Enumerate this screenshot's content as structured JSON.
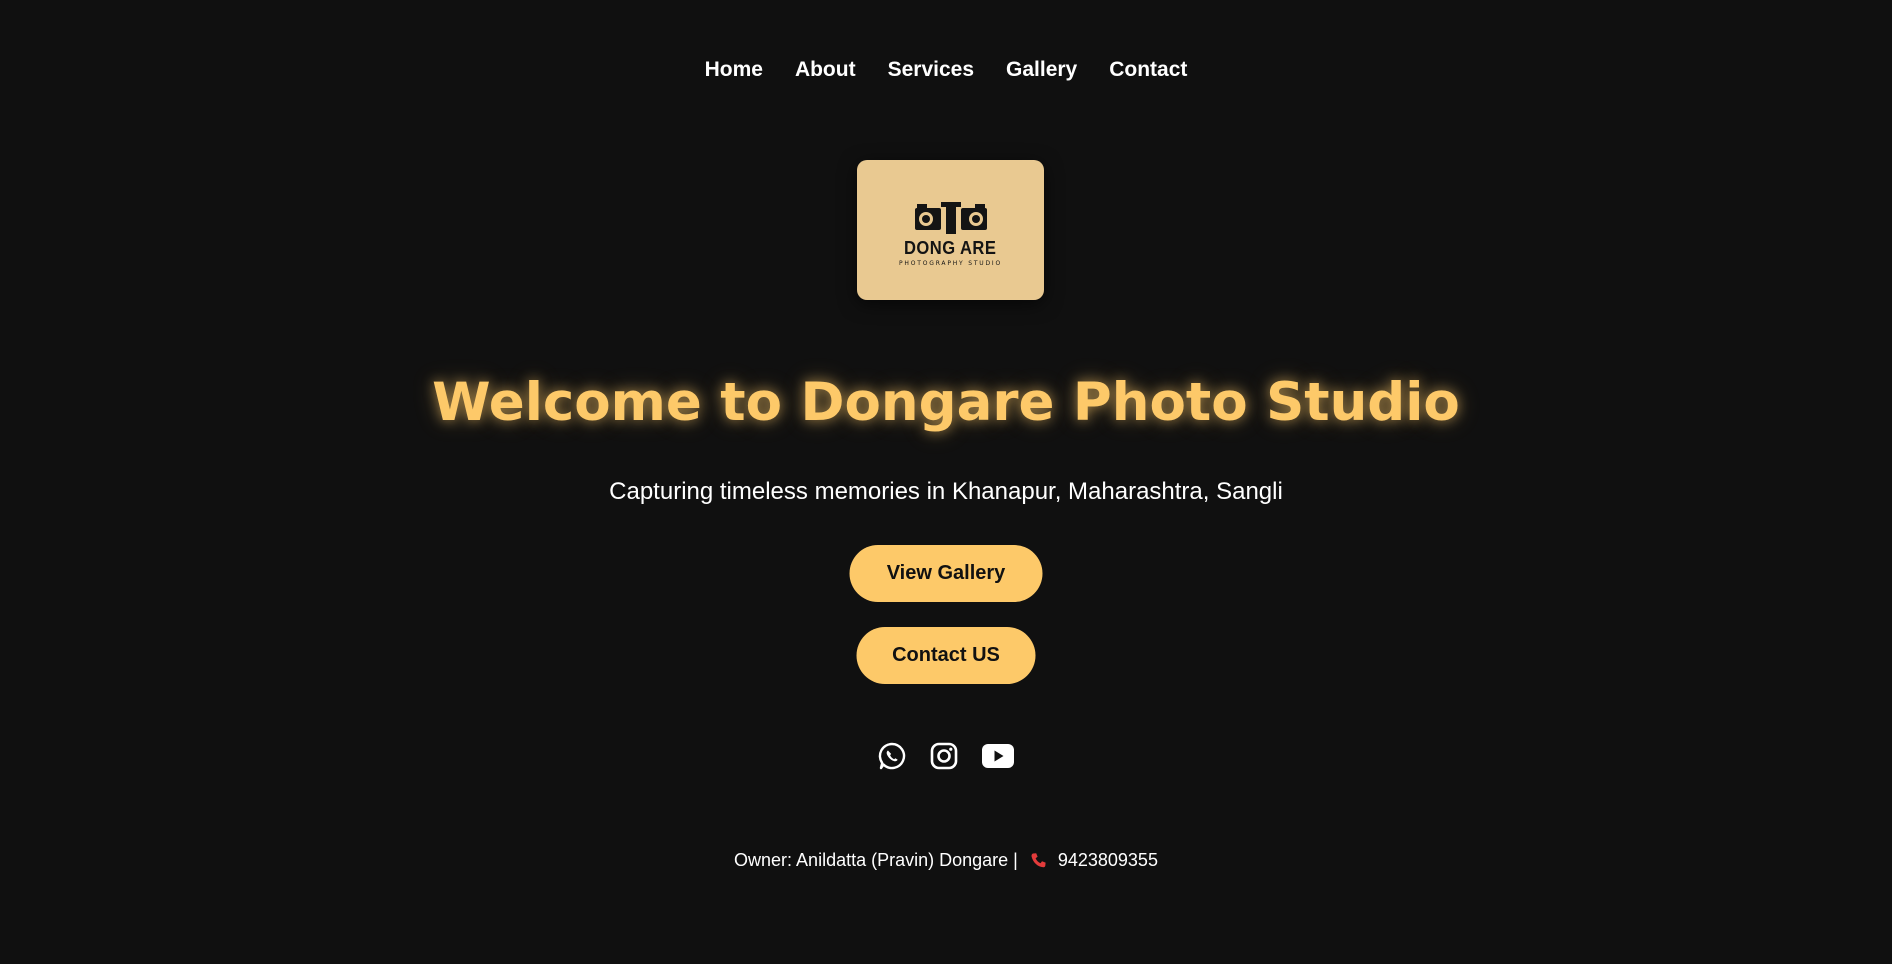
{
  "nav": {
    "items": [
      "Home",
      "About",
      "Services",
      "Gallery",
      "Contact"
    ]
  },
  "logo": {
    "name": "DONG ARE",
    "tagline": "PHOTOGRAPHY STUDIO",
    "background": "#e9c991"
  },
  "hero": {
    "title": "Welcome to Dongare Photo Studio",
    "subtitle": "Capturing timeless memories in Khanapur, Maharashtra, Sangli",
    "accent": "#fdc969"
  },
  "buttons": {
    "gallery_label": "View Gallery",
    "contact_label": "Contact US"
  },
  "socials": [
    "whatsapp-icon",
    "instagram-icon",
    "youtube-icon"
  ],
  "footer": {
    "owner_text": "Owner: Anildatta (Pravin) Dongare |",
    "phone_icon": "phone-icon",
    "phone": "9423809355"
  },
  "colors": {
    "background": "#101010",
    "accent": "#fdc969",
    "phone_icon": "#e33b3b"
  }
}
